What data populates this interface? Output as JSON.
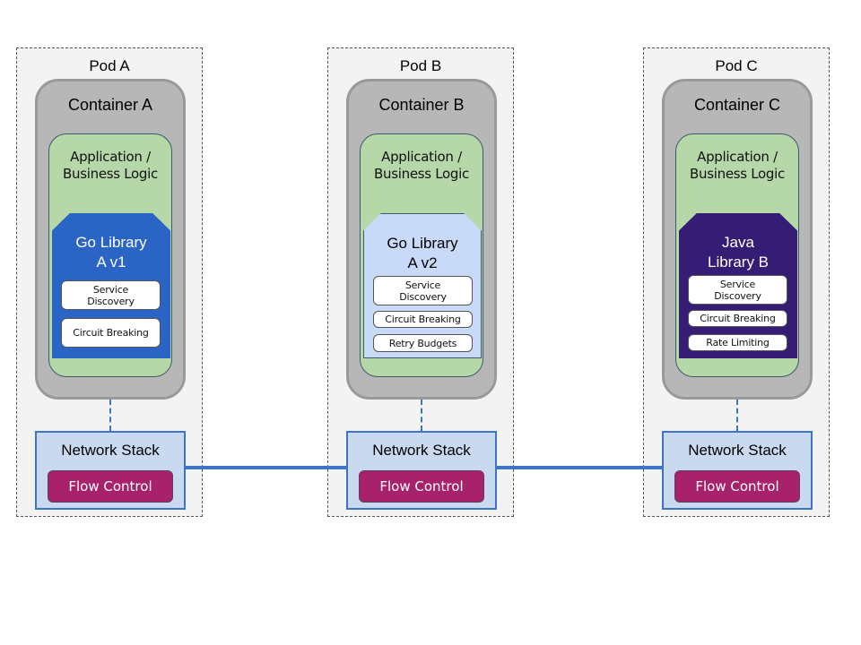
{
  "colors": {
    "pod_bg": "#f3f3f3",
    "container_bg": "#b7b7b7",
    "app_bg": "#b6d7a8",
    "network_bg": "#c9daf0",
    "network_border": "#3d74c6",
    "flow_control_bg": "#a8216b",
    "link_color": "#3d74c6"
  },
  "pods": [
    {
      "title": "Pod A",
      "container": "Container A",
      "app": "Application / Business Logic",
      "library": {
        "title_line1": "Go Library",
        "title_line2": "A v1",
        "bg": "#2a65c6",
        "fg": "#ffffff"
      },
      "features": [
        "Service Discovery",
        "Circuit Breaking"
      ],
      "network": "Network Stack",
      "flow": "Flow Control"
    },
    {
      "title": "Pod B",
      "container": "Container B",
      "app": "Application / Business Logic",
      "library": {
        "title_line1": "Go Library",
        "title_line2": "A v2",
        "bg": "#c9daf8",
        "fg": "#000000"
      },
      "features": [
        "Service Discovery",
        "Circuit Breaking",
        "Retry Budgets"
      ],
      "network": "Network Stack",
      "flow": "Flow Control"
    },
    {
      "title": "Pod C",
      "container": "Container C",
      "app": "Application / Business Logic",
      "library": {
        "title_line1": "Java",
        "title_line2": "Library B",
        "bg": "#351c75",
        "fg": "#ffffff"
      },
      "features": [
        "Service Discovery",
        "Circuit Breaking",
        "Rate Limiting"
      ],
      "network": "Network Stack",
      "flow": "Flow Control"
    }
  ]
}
